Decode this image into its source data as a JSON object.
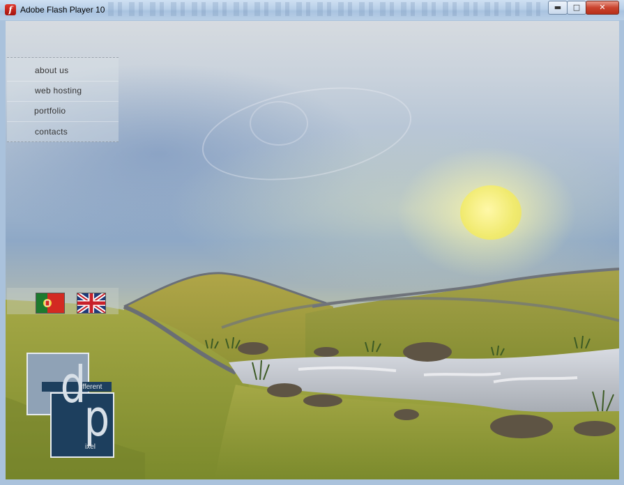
{
  "window": {
    "title": "Adobe Flash Player 10",
    "app_icon": "flash-icon",
    "controls": {
      "minimize": "minimize-icon",
      "maximize": "maximize-icon",
      "close": "close-icon"
    }
  },
  "menu": {
    "items": [
      {
        "label": "about us"
      },
      {
        "label": "web hosting"
      },
      {
        "label": "portfolio"
      },
      {
        "label": "contacts"
      }
    ]
  },
  "languages": [
    {
      "code": "pt",
      "icon": "portugal-flag-icon"
    },
    {
      "code": "en",
      "icon": "united-kingdom-flag-icon"
    }
  ],
  "logo": {
    "word1": "ifferent",
    "word2": "ixel",
    "colors": {
      "dark": "#1d3f5e",
      "light": "#8fa2b6"
    }
  },
  "colors": {
    "sky": "#8ea8c6",
    "sun": "#f0ea6e",
    "grass": "#8f9a35",
    "river": "#c8ccd4"
  }
}
